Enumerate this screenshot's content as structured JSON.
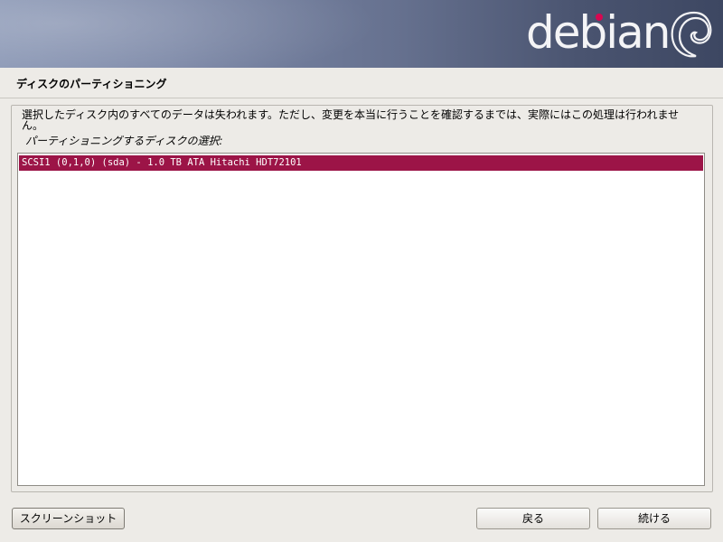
{
  "banner": {
    "logo_text": "debian",
    "logo_dot_color": "#d70751"
  },
  "step_title": "ディスクのパーティショニング",
  "description": "選択したディスク内のすべてのデータは失われます。ただし、変更を本当に行うことを確認するまでは、実際にはこの処理は行われません。",
  "prompt": "パーティショニングするディスクの選択:",
  "disks": [
    {
      "label": "SCSI1 (0,1,0) (sda) - 1.0 TB ATA Hitachi HDT72101",
      "selected": true
    }
  ],
  "buttons": {
    "screenshot": "スクリーンショット",
    "back": "戻る",
    "continue": "続ける"
  },
  "colors": {
    "selection": "#9c1447",
    "background": "#edebe7"
  }
}
